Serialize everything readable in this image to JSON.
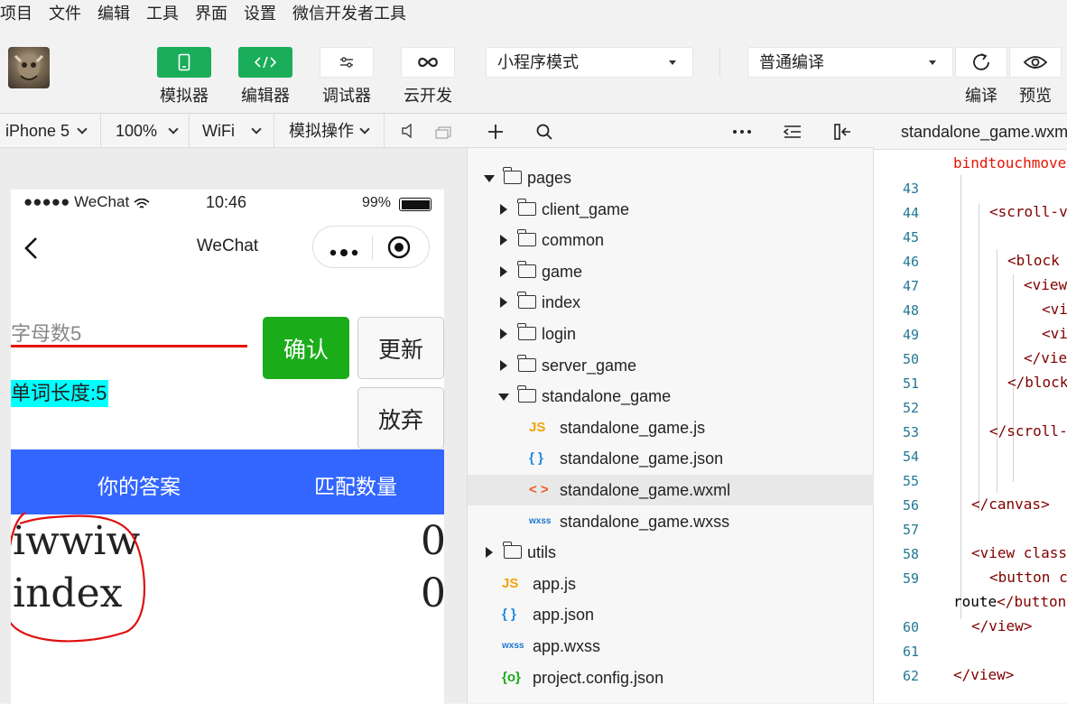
{
  "menu": [
    "项目",
    "文件",
    "编辑",
    "工具",
    "界面",
    "设置",
    "微信开发者工具"
  ],
  "toolbar": {
    "simulator_label": "模拟器",
    "editor_label": "编辑器",
    "debugger_label": "调试器",
    "cloud_label": "云开发",
    "mode_select": "小程序模式",
    "compile_select": "普通编译",
    "compile_label": "编译",
    "preview_label": "预览",
    "accent": "#1aad5a"
  },
  "simbar": {
    "device": "iPhone 5",
    "zoom": "100%",
    "network": "WiFi",
    "sim_ops": "模拟操作"
  },
  "phone": {
    "signal": "●●●●● WeChat",
    "time": "10:46",
    "battery": "99%",
    "nav_title": "WeChat",
    "input_placeholder": "字母数5",
    "confirm_btn": "确认",
    "update_btn": "更新",
    "word_length": "单词长度:5",
    "give_up_btn": "放弃",
    "header_answer": "你的答案",
    "header_match": "匹配数量",
    "header_color": "#3366ff",
    "rows": [
      {
        "word": "iwwiw",
        "count": "0"
      },
      {
        "word": "index",
        "count": "0"
      }
    ]
  },
  "tree": [
    {
      "label": "pages",
      "type": "folder-open",
      "depth": 0
    },
    {
      "label": "client_game",
      "type": "folder",
      "depth": 1
    },
    {
      "label": "common",
      "type": "folder",
      "depth": 1
    },
    {
      "label": "game",
      "type": "folder",
      "depth": 1
    },
    {
      "label": "index",
      "type": "folder",
      "depth": 1
    },
    {
      "label": "login",
      "type": "folder",
      "depth": 1
    },
    {
      "label": "server_game",
      "type": "folder",
      "depth": 1
    },
    {
      "label": "standalone_game",
      "type": "folder-open",
      "depth": 1
    },
    {
      "label": "standalone_game.js",
      "type": "js",
      "depth": 2
    },
    {
      "label": "standalone_game.json",
      "type": "json",
      "depth": 2
    },
    {
      "label": "standalone_game.wxml",
      "type": "wxml",
      "depth": 2,
      "selected": true
    },
    {
      "label": "standalone_game.wxss",
      "type": "wxss",
      "depth": 2
    },
    {
      "label": "utils",
      "type": "folder",
      "depth": 0
    },
    {
      "label": "app.js",
      "type": "js",
      "depth": 0
    },
    {
      "label": "app.json",
      "type": "json",
      "depth": 0
    },
    {
      "label": "app.wxss",
      "type": "wxss",
      "depth": 0
    },
    {
      "label": "project.config.json",
      "type": "config",
      "depth": 0
    }
  ],
  "editor": {
    "tab": "standalone_game.wxml",
    "lines": [
      {
        "n": "",
        "text": "bindtouchmove",
        "cls": "red"
      },
      {
        "n": "43",
        "text": ""
      },
      {
        "n": "44",
        "text": "<scroll-v",
        "cls": "tag"
      },
      {
        "n": "45",
        "text": ""
      },
      {
        "n": "46",
        "text": "<block",
        "cls": "tag"
      },
      {
        "n": "47",
        "text": "<view",
        "cls": "tag"
      },
      {
        "n": "48",
        "text": "<vi",
        "cls": "tag"
      },
      {
        "n": "49",
        "text": "<vi",
        "cls": "tag"
      },
      {
        "n": "50",
        "text": "</vie",
        "cls": "tag"
      },
      {
        "n": "51",
        "text": "</block",
        "cls": "tag"
      },
      {
        "n": "52",
        "text": ""
      },
      {
        "n": "53",
        "text": "</scroll-",
        "cls": "tag"
      },
      {
        "n": "54",
        "text": ""
      },
      {
        "n": "55",
        "text": ""
      },
      {
        "n": "56",
        "text": "</canvas>",
        "cls": "tag"
      },
      {
        "n": "57",
        "text": ""
      },
      {
        "n": "58",
        "text": "<view class",
        "cls": "tag"
      },
      {
        "n": "59",
        "text": "<button c",
        "cls": "tag"
      },
      {
        "n": "",
        "text": "route</button",
        "mixed": true
      },
      {
        "n": "60",
        "text": "</view>",
        "cls": "tag"
      },
      {
        "n": "61",
        "text": ""
      },
      {
        "n": "62",
        "text": "</view>",
        "cls": "tag"
      }
    ]
  }
}
